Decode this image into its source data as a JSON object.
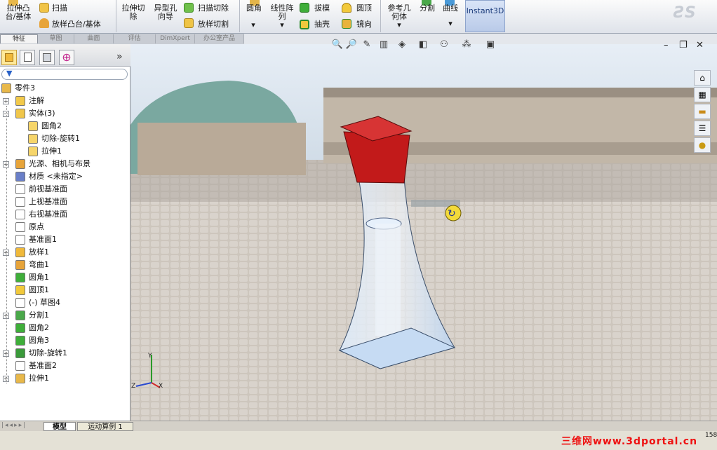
{
  "ribbon": {
    "buttons": [
      {
        "id": "extrude-boss",
        "label1": "拉伸凸",
        "label2": "台/基体"
      },
      {
        "id": "sweep",
        "label1": "扫描",
        "label2": ""
      },
      {
        "id": "loft-boss",
        "label1": "放样凸台/基体",
        "label2": ""
      },
      {
        "id": "extrude-cut",
        "label1": "拉伸切",
        "label2": "除"
      },
      {
        "id": "hole-wizard",
        "label1": "异型孔",
        "label2": "向导"
      },
      {
        "id": "swept-cut",
        "label1": "扫描切除",
        "label2": ""
      },
      {
        "id": "lofted-cut",
        "label1": "放样切割",
        "label2": ""
      },
      {
        "id": "fillet",
        "label1": "圆角",
        "label2": ""
      },
      {
        "id": "linear-pattern",
        "label1": "线性阵",
        "label2": "列"
      },
      {
        "id": "draft",
        "label1": "拔模",
        "label2": ""
      },
      {
        "id": "shell",
        "label1": "抽壳",
        "label2": ""
      },
      {
        "id": "dome",
        "label1": "圆顶",
        "label2": ""
      },
      {
        "id": "mirror",
        "label1": "镜向",
        "label2": ""
      },
      {
        "id": "ref-geometry",
        "label1": "参考几",
        "label2": "何体"
      },
      {
        "id": "split",
        "label1": "分割",
        "label2": ""
      },
      {
        "id": "curves",
        "label1": "曲线",
        "label2": ""
      }
    ],
    "instant3d": "Instant3D",
    "tabs": [
      "特征",
      "草图",
      "曲面",
      "评估",
      "DimXpert",
      "办公室产品"
    ]
  },
  "panel": {
    "tabs": [
      "feature-manager-icon",
      "property-manager-icon",
      "configuration-manager-icon",
      "dimxpert-manager-icon"
    ],
    "more": "»",
    "tree": [
      {
        "label": "零件3",
        "level": 0,
        "icon": "part-icon",
        "expand": ""
      },
      {
        "label": "注解",
        "level": 1,
        "icon": "annotation-icon",
        "expand": "+"
      },
      {
        "label": "实体(3)",
        "level": 1,
        "icon": "solid-bodies-icon",
        "expand": "−"
      },
      {
        "label": "圆角2",
        "level": 2,
        "icon": "body-icon",
        "expand": ""
      },
      {
        "label": "切除-旋转1",
        "level": 2,
        "icon": "body-icon",
        "expand": ""
      },
      {
        "label": "拉伸1",
        "level": 2,
        "icon": "body-icon",
        "expand": ""
      },
      {
        "label": "光源、相机与布景",
        "level": 1,
        "icon": "lights-icon",
        "expand": "+"
      },
      {
        "label": "材质 <未指定>",
        "level": 1,
        "icon": "material-icon",
        "expand": ""
      },
      {
        "label": "前视基准面",
        "level": 1,
        "icon": "plane-icon",
        "expand": ""
      },
      {
        "label": "上视基准面",
        "level": 1,
        "icon": "plane-icon",
        "expand": ""
      },
      {
        "label": "右视基准面",
        "level": 1,
        "icon": "plane-icon",
        "expand": ""
      },
      {
        "label": "原点",
        "level": 1,
        "icon": "origin-icon",
        "expand": ""
      },
      {
        "label": "基准面1",
        "level": 1,
        "icon": "plane-icon",
        "expand": ""
      },
      {
        "label": "放样1",
        "level": 1,
        "icon": "loft-icon",
        "expand": "+"
      },
      {
        "label": "弯曲1",
        "level": 1,
        "icon": "flex-icon",
        "expand": ""
      },
      {
        "label": "圆角1",
        "level": 1,
        "icon": "fillet-icon",
        "expand": ""
      },
      {
        "label": "圆顶1",
        "level": 1,
        "icon": "dome-icon",
        "expand": ""
      },
      {
        "label": "(-) 草图4",
        "level": 1,
        "icon": "sketch-icon",
        "expand": ""
      },
      {
        "label": "分割1",
        "level": 1,
        "icon": "split-icon",
        "expand": "+"
      },
      {
        "label": "圆角2",
        "level": 1,
        "icon": "fillet-icon",
        "expand": ""
      },
      {
        "label": "圆角3",
        "level": 1,
        "icon": "fillet-icon",
        "expand": ""
      },
      {
        "label": "切除-旋转1",
        "level": 1,
        "icon": "revolve-cut-icon",
        "expand": "+"
      },
      {
        "label": "基准面2",
        "level": 1,
        "icon": "plane-icon",
        "expand": ""
      },
      {
        "label": "拉伸1",
        "level": 1,
        "icon": "extrude-icon",
        "expand": "+"
      }
    ]
  },
  "bottom_tabs": [
    "模型",
    "运动算例 1"
  ],
  "watermark": "三维网www.3dportal.cn",
  "side_value": "158",
  "colors": {
    "cap": "#c21a1a",
    "glass": "#cfe2f7",
    "sky": "#dde8f2",
    "ground": "#cfc7bd"
  }
}
